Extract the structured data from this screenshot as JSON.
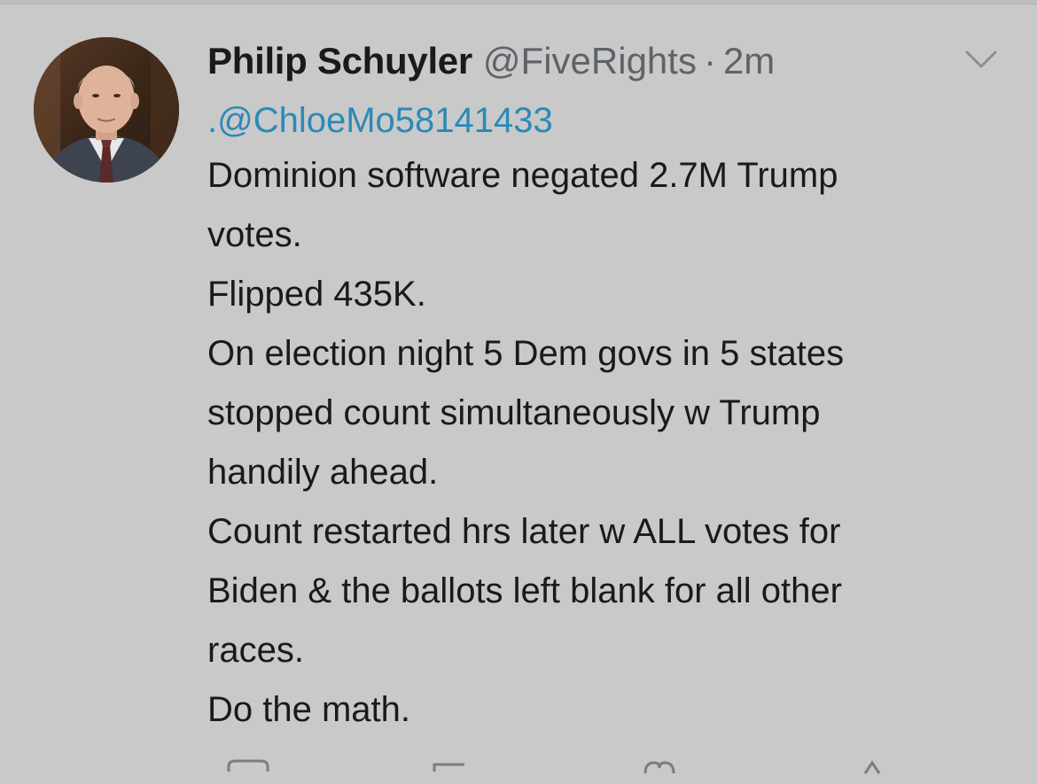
{
  "tweet": {
    "display_name": "Philip Schuyler",
    "handle": "@FiveRights",
    "separator": "·",
    "time": "2m",
    "reply_to": ".@ChloeMo58141433",
    "body_lines": [
      "Dominion software negated 2.7M Trump",
      "votes.",
      "Flipped 435K.",
      "On election night 5 Dem govs in 5 states",
      "stopped count simultaneously w Trump",
      "handily ahead.",
      "Count restarted hrs later w ALL votes for",
      "Biden & the ballots left blank for all other",
      "races.",
      "Do the math."
    ]
  },
  "icons": {
    "menu": "chevron-down-icon",
    "reply": "reply-icon",
    "retweet": "retweet-icon",
    "like": "heart-icon",
    "share": "share-icon"
  },
  "colors": {
    "background": "#c9c9c9",
    "text": "#1a1a1a",
    "secondary": "#5f6368",
    "link": "#2a8ab8"
  }
}
